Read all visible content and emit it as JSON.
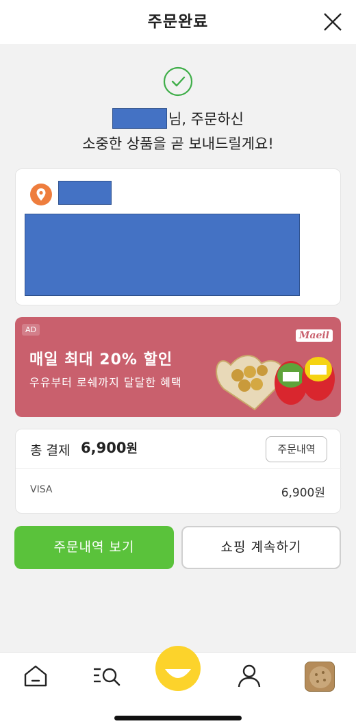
{
  "header": {
    "title": "주문완료"
  },
  "confirmation": {
    "line1_suffix": "님, 주문하신",
    "line2": "소중한 상품을 곧 보내드릴게요!"
  },
  "ad": {
    "badge": "AD",
    "title": "매일 최대 20% 할인",
    "subtitle": "우유부터 로쉐까지 달달한 혜택",
    "brand": "Maeil"
  },
  "payment": {
    "label": "총 결제",
    "total": "6,900",
    "total_unit": "원",
    "order_history_chip": "주문내역",
    "method": "VISA",
    "method_amount": "6,900원"
  },
  "actions": {
    "view_orders": "주문내역 보기",
    "continue_shopping": "쇼핑 계속하기"
  },
  "colors": {
    "accent_green": "#5ac23b",
    "ad_background": "#c9606d",
    "check": "#3fae49",
    "pin": "#ee7d3d",
    "center_tab": "#fcd32b"
  }
}
